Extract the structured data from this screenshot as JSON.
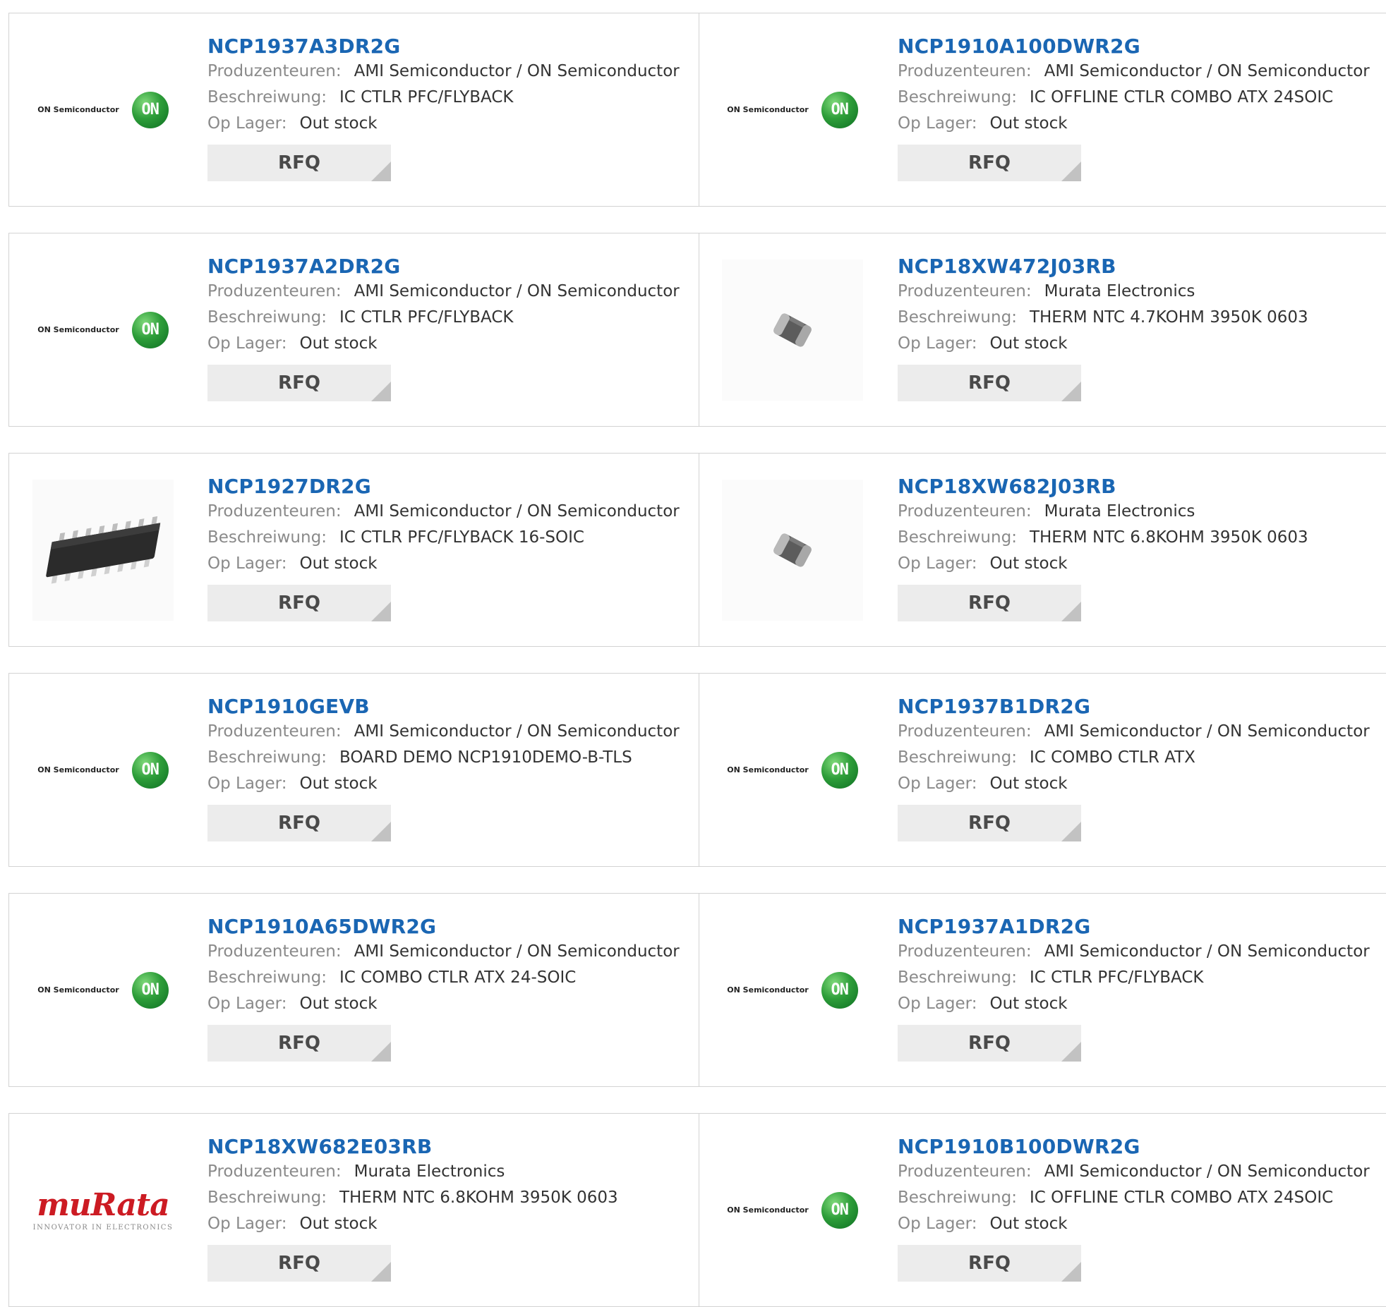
{
  "labels": {
    "manufacturer": "Produzenteuren:",
    "description": "Beschreiwung:",
    "stock": "Op Lager:",
    "rfq": "RFQ"
  },
  "logos": {
    "on_text": "ON Semiconductor",
    "on_ball": "ON",
    "murata_word": "muRata",
    "murata_tag": "INNOVATOR IN ELECTRONICS"
  },
  "colors": {
    "part_link": "#1a66b3",
    "rfq_bg": "#ececec",
    "on_green": "#2e9e3a",
    "murata_red": "#cc1b23"
  },
  "products": [
    {
      "part": "NCP1937A3DR2G",
      "manufacturer": "AMI Semiconductor / ON Semiconductor",
      "description": "IC CTLR PFC/FLYBACK",
      "stock": "Out stock",
      "image": "on-semiconductor-logo"
    },
    {
      "part": "NCP1910A100DWR2G",
      "manufacturer": "AMI Semiconductor / ON Semiconductor",
      "description": "IC OFFLINE CTLR COMBO ATX 24SOIC",
      "stock": "Out stock",
      "image": "on-semiconductor-logo"
    },
    {
      "part": "NCP1937A2DR2G",
      "manufacturer": "AMI Semiconductor / ON Semiconductor",
      "description": "IC CTLR PFC/FLYBACK",
      "stock": "Out stock",
      "image": "on-semiconductor-logo"
    },
    {
      "part": "NCP18XW472J03RB",
      "manufacturer": "Murata Electronics",
      "description": "THERM NTC 4.7KOHM 3950K 0603",
      "stock": "Out stock",
      "image": "smd-thermistor"
    },
    {
      "part": "NCP1927DR2G",
      "manufacturer": "AMI Semiconductor / ON Semiconductor",
      "description": "IC CTLR PFC/FLYBACK 16-SOIC",
      "stock": "Out stock",
      "image": "soic-16-chip"
    },
    {
      "part": "NCP18XW682J03RB",
      "manufacturer": "Murata Electronics",
      "description": "THERM NTC 6.8KOHM 3950K 0603",
      "stock": "Out stock",
      "image": "smd-thermistor"
    },
    {
      "part": "NCP1910GEVB",
      "manufacturer": "AMI Semiconductor / ON Semiconductor",
      "description": "BOARD DEMO NCP1910DEMO-B-TLS",
      "stock": "Out stock",
      "image": "on-semiconductor-logo"
    },
    {
      "part": "NCP1937B1DR2G",
      "manufacturer": "AMI Semiconductor / ON Semiconductor",
      "description": "IC COMBO CTLR ATX",
      "stock": "Out stock",
      "image": "on-semiconductor-logo"
    },
    {
      "part": "NCP1910A65DWR2G",
      "manufacturer": "AMI Semiconductor / ON Semiconductor",
      "description": "IC COMBO CTLR ATX 24-SOIC",
      "stock": "Out stock",
      "image": "on-semiconductor-logo"
    },
    {
      "part": "NCP1937A1DR2G",
      "manufacturer": "AMI Semiconductor / ON Semiconductor",
      "description": "IC CTLR PFC/FLYBACK",
      "stock": "Out stock",
      "image": "on-semiconductor-logo"
    },
    {
      "part": "NCP18XW682E03RB",
      "manufacturer": "Murata Electronics",
      "description": "THERM NTC 6.8KOHM 3950K 0603",
      "stock": "Out stock",
      "image": "murata-logo"
    },
    {
      "part": "NCP1910B100DWR2G",
      "manufacturer": "AMI Semiconductor / ON Semiconductor",
      "description": "IC OFFLINE CTLR COMBO ATX 24SOIC",
      "stock": "Out stock",
      "image": "on-semiconductor-logo"
    }
  ]
}
